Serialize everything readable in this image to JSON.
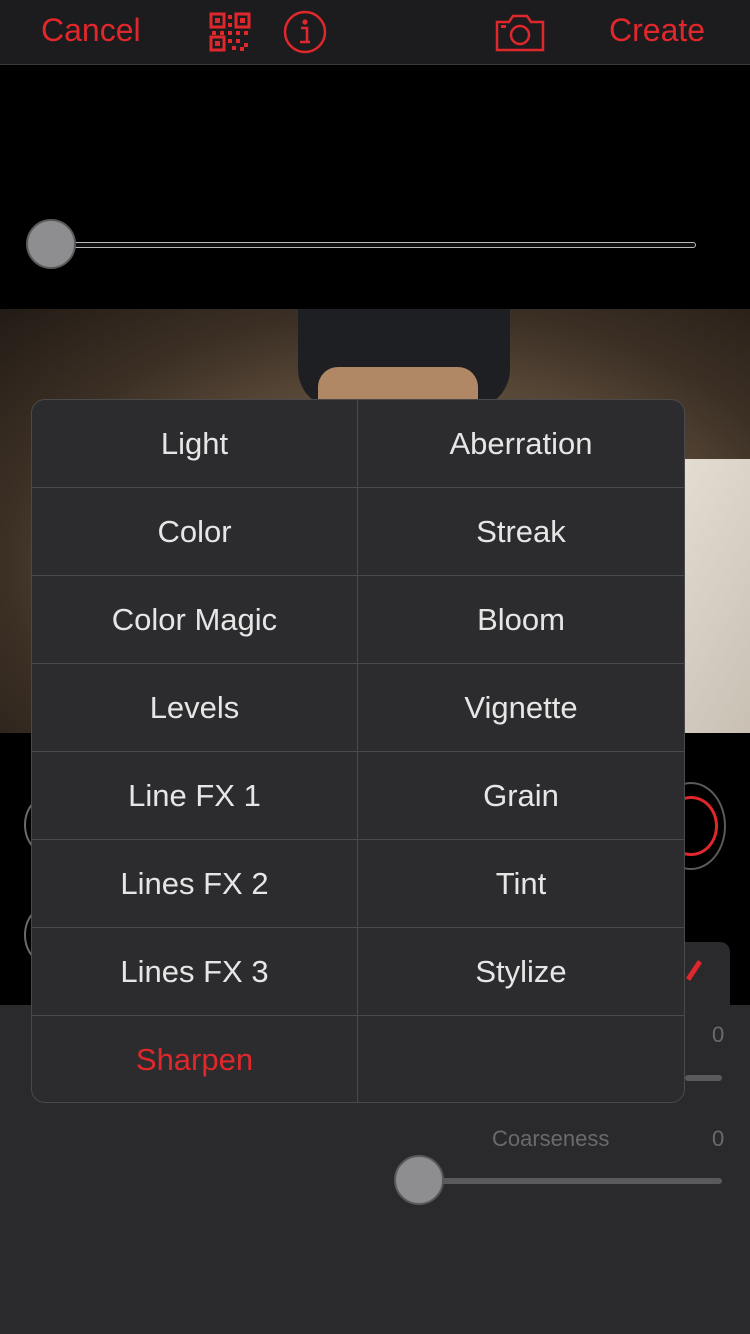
{
  "topbar": {
    "cancel_label": "Cancel",
    "create_label": "Create",
    "qr_icon": "qr-code-icon",
    "info_icon": "info-icon",
    "camera_icon": "camera-icon"
  },
  "colors": {
    "accent": "#e0272b",
    "menu_bg": "#2c2c2e",
    "panel_bg": "#2a2a2c"
  },
  "top_slider": {
    "value": 0
  },
  "menu": {
    "items": [
      {
        "label": "Light"
      },
      {
        "label": "Aberration"
      },
      {
        "label": "Color"
      },
      {
        "label": "Streak"
      },
      {
        "label": "Color Magic"
      },
      {
        "label": "Bloom"
      },
      {
        "label": "Levels"
      },
      {
        "label": "Vignette"
      },
      {
        "label": "Line FX 1"
      },
      {
        "label": "Grain"
      },
      {
        "label": "Lines FX 2"
      },
      {
        "label": "Tint"
      },
      {
        "label": "Lines FX 3"
      },
      {
        "label": "Stylize"
      },
      {
        "label": "Sharpen",
        "selected": true
      },
      {
        "label": ""
      }
    ]
  },
  "panel": {
    "first_value": "0",
    "coarseness_label": "Coarseness",
    "coarseness_value": "0"
  }
}
